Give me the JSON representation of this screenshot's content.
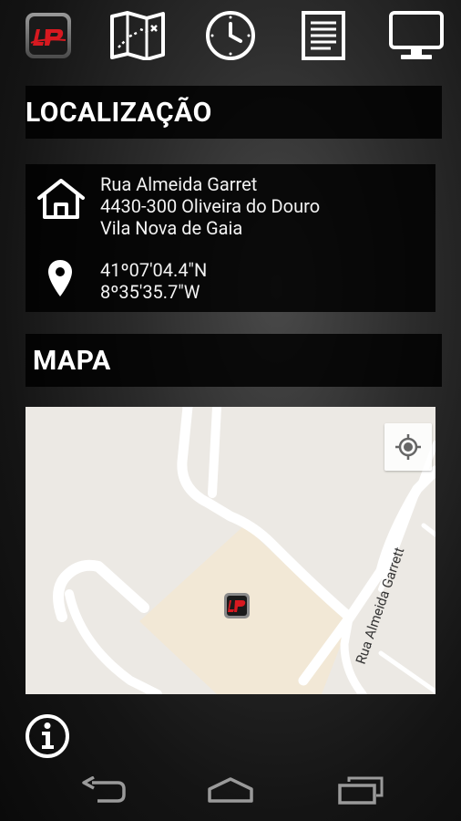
{
  "toolbar": {
    "items": [
      {
        "icon": "app-logo-icon"
      },
      {
        "icon": "map-icon"
      },
      {
        "icon": "clock-icon"
      },
      {
        "icon": "document-icon"
      },
      {
        "icon": "monitor-icon"
      }
    ]
  },
  "location": {
    "title": "LOCALIZAÇÃO",
    "address_line1": "Rua Almeida Garret",
    "address_line2": "4430-300 Oliveira do Douro",
    "address_line3": "Vila Nova de Gaia",
    "latitude": "41º07'04.4\"N",
    "longitude": "8º35'35.7\"W"
  },
  "map": {
    "title": "MAPA",
    "street_label": "Rua Almeida Garrett"
  },
  "colors": {
    "accent_red": "#d71920",
    "header_bg": "#000000",
    "map_bg": "#ece9e4",
    "map_area": "#f2e8d6"
  }
}
